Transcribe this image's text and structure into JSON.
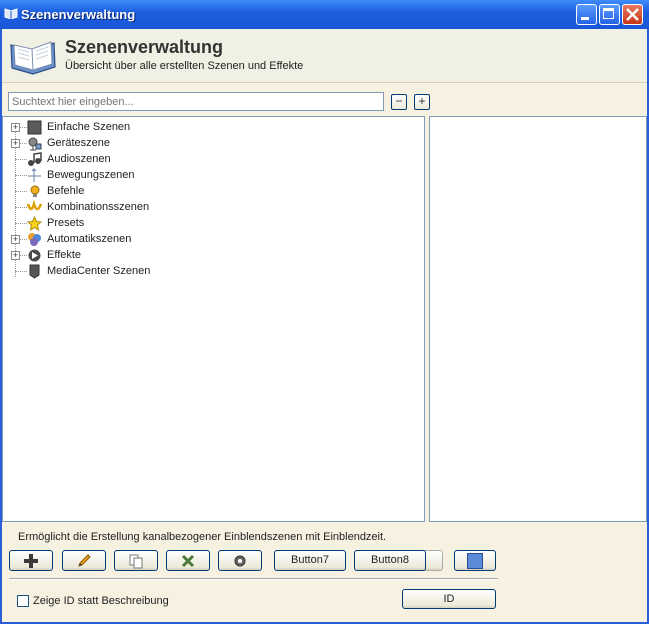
{
  "window": {
    "title": "Szenenverwaltung"
  },
  "header": {
    "title": "Szenenverwaltung",
    "subtitle": "Übersicht über alle erstellten Szenen und Effekte"
  },
  "search": {
    "placeholder": "Suchtext hier eingeben...",
    "minus_label": "−",
    "plus_label": "+"
  },
  "tree": {
    "items": [
      {
        "label": "Einfache Szenen",
        "expandable": true,
        "icon": "stop-square-icon"
      },
      {
        "label": "Geräteszene",
        "expandable": true,
        "icon": "devices-icon"
      },
      {
        "label": "Audioszenen",
        "expandable": false,
        "icon": "music-note-icon"
      },
      {
        "label": "Bewegungszenen",
        "expandable": false,
        "icon": "motion-icon"
      },
      {
        "label": "Befehle",
        "expandable": false,
        "icon": "lightbulb-icon"
      },
      {
        "label": "Kombinationsszenen",
        "expandable": false,
        "icon": "combination-icon"
      },
      {
        "label": "Presets",
        "expandable": false,
        "icon": "star-icon"
      },
      {
        "label": "Automatikszenen",
        "expandable": true,
        "icon": "automatic-icon"
      },
      {
        "label": "Effekte",
        "expandable": true,
        "icon": "effects-icon"
      },
      {
        "label": "MediaCenter Szenen",
        "expandable": false,
        "icon": "mediacenter-icon"
      }
    ]
  },
  "status": {
    "text": "Ermöglicht die Erstellung kanalbezogener Einblendszenen mit Einblendzeit."
  },
  "toolbar": {
    "button7_label": "Button7",
    "button8_label": "Button8"
  },
  "footer": {
    "checkbox_label": "Zeige ID statt Beschreibung",
    "id_button_label": "ID"
  },
  "colors": {
    "titlebar": "#1d5fe0",
    "panel_bg": "#f6f1e1",
    "header_bg": "#f0f0e4",
    "border": "#7f9db9"
  }
}
